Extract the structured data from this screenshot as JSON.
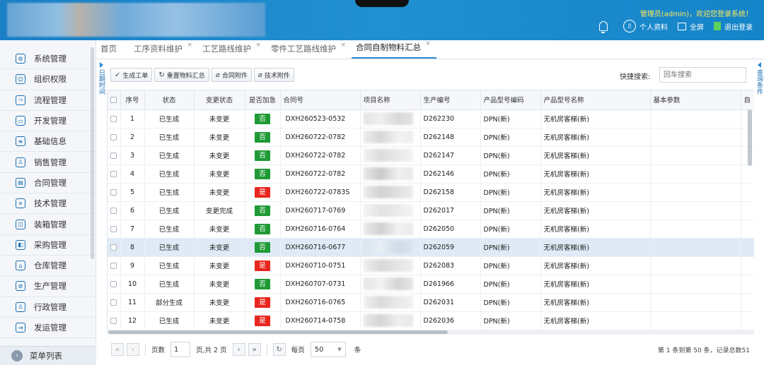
{
  "header": {
    "welcome": "管理员(admin)，欢迎您登录系统！",
    "actions": [
      {
        "label": "个人资料",
        "icon": "user-grid-icon"
      },
      {
        "label": "全屏",
        "icon": "fullscreen-icon"
      },
      {
        "label": "退出登录",
        "icon": "logout-icon"
      }
    ]
  },
  "sidebar": {
    "items": [
      {
        "label": "系统管理",
        "icon": "system-icon"
      },
      {
        "label": "组织权限",
        "icon": "org-icon"
      },
      {
        "label": "流程管理",
        "icon": "flow-icon"
      },
      {
        "label": "开发管理",
        "icon": "dev-icon"
      },
      {
        "label": "基础信息",
        "icon": "database-icon"
      },
      {
        "label": "销售管理",
        "icon": "sales-icon"
      },
      {
        "label": "合同管理",
        "icon": "contract-icon"
      },
      {
        "label": "技术管理",
        "icon": "tools-icon"
      },
      {
        "label": "装箱管理",
        "icon": "box-icon"
      },
      {
        "label": "采购管理",
        "icon": "purchase-icon"
      },
      {
        "label": "仓库管理",
        "icon": "warehouse-icon"
      },
      {
        "label": "生产管理",
        "icon": "production-icon"
      },
      {
        "label": "行政管理",
        "icon": "admin-icon"
      },
      {
        "label": "发运管理",
        "icon": "shipping-icon"
      }
    ],
    "menu_list": "菜单列表"
  },
  "tabs": [
    {
      "label": "首页",
      "closable": false,
      "active": false
    },
    {
      "label": "工序资料维护",
      "closable": true,
      "active": false
    },
    {
      "label": "工艺路线维护",
      "closable": true,
      "active": false
    },
    {
      "label": "零件工艺路线维护",
      "closable": true,
      "active": false
    },
    {
      "label": "合同自制物料汇总",
      "closable": true,
      "active": true
    }
  ],
  "left_collapse": "日期时间",
  "right_collapse": "查询条件",
  "toolbar": {
    "buttons": [
      {
        "label": "生成工单",
        "icon": "✓"
      },
      {
        "label": "重置物料汇总",
        "icon": "↻"
      },
      {
        "label": "合同附件",
        "icon": "⌀"
      },
      {
        "label": "技术附件",
        "icon": "⌀"
      }
    ],
    "quick_search_label": "快捷搜索:",
    "quick_search_placeholder": "回车搜索"
  },
  "table": {
    "columns": [
      "序号",
      "状态",
      "变更状态",
      "是否加急",
      "合同号",
      "项目名称",
      "生产编号",
      "产品型号编码",
      "产品型号名称",
      "基本参数",
      "自"
    ],
    "rows": [
      {
        "no": "1",
        "status": "已生成",
        "change": "未变更",
        "urgent": "否",
        "contract": "DXH260523-0532",
        "prod": "D262230",
        "code": "DPN(新)",
        "name": "无机房客梯(新)"
      },
      {
        "no": "2",
        "status": "已生成",
        "change": "未变更",
        "urgent": "否",
        "contract": "DXH260722-0782",
        "prod": "D262148",
        "code": "DPN(新)",
        "name": "无机房客梯(新)"
      },
      {
        "no": "3",
        "status": "已生成",
        "change": "未变更",
        "urgent": "否",
        "contract": "DXH260722-0782",
        "prod": "D262147",
        "code": "DPN(新)",
        "name": "无机房客梯(新)"
      },
      {
        "no": "4",
        "status": "已生成",
        "change": "未变更",
        "urgent": "否",
        "contract": "DXH260722-0782",
        "prod": "D262146",
        "code": "DPN(新)",
        "name": "无机房客梯(新)"
      },
      {
        "no": "5",
        "status": "已生成",
        "change": "未变更",
        "urgent": "是",
        "contract": "DXH260722-0783S",
        "prod": "D262158",
        "code": "DPN(新)",
        "name": "无机房客梯(新)"
      },
      {
        "no": "6",
        "status": "已生成",
        "change": "变更完成",
        "urgent": "否",
        "contract": "DXH260717-0769",
        "prod": "D262017",
        "code": "DPN(新)",
        "name": "无机房客梯(新)"
      },
      {
        "no": "7",
        "status": "已生成",
        "change": "未变更",
        "urgent": "否",
        "contract": "DXH260716-0764",
        "prod": "D262050",
        "code": "DPN(新)",
        "name": "无机房客梯(新)"
      },
      {
        "no": "8",
        "status": "已生成",
        "change": "未变更",
        "urgent": "否",
        "contract": "DXH260716-0677",
        "prod": "D262059",
        "code": "DPN(新)",
        "name": "无机房客梯(新)"
      },
      {
        "no": "9",
        "status": "已生成",
        "change": "未变更",
        "urgent": "是",
        "contract": "DXH260710-0751",
        "prod": "D262083",
        "code": "DPN(新)",
        "name": "无机房客梯(新)"
      },
      {
        "no": "10",
        "status": "已生成",
        "change": "未变更",
        "urgent": "否",
        "contract": "DXH260707-0731",
        "prod": "D261966",
        "code": "DPN(新)",
        "name": "无机房客梯(新)"
      },
      {
        "no": "11",
        "status": "部分生成",
        "change": "未变更",
        "urgent": "是",
        "contract": "DXH260716-0765",
        "prod": "D262031",
        "code": "DPN(新)",
        "name": "无机房客梯(新)"
      },
      {
        "no": "12",
        "status": "已生成",
        "change": "未变更",
        "urgent": "是",
        "contract": "DXH260714-0758",
        "prod": "D262036",
        "code": "DPN(新)",
        "name": "无机房客梯(新)"
      }
    ],
    "selected_row": 8
  },
  "pager": {
    "page_label": "页数",
    "page_value": "1",
    "total_pages": "页,共 2 页",
    "per_page_label": "每页",
    "per_page_value": "50",
    "unit": "条",
    "info": "第 1 条到第 50 条，记录总数51"
  },
  "colors": {
    "header": "#1a7fc4",
    "urgent_no": "#1f9a36",
    "urgent_yes": "#e8261d",
    "accent": "#2a8ad6"
  }
}
